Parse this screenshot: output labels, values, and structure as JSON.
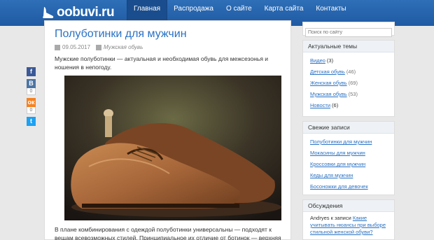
{
  "header": {
    "logo_text": "oobuvi.ru",
    "nav": [
      {
        "label": "Главная",
        "active": true
      },
      {
        "label": "Распродажа",
        "active": false
      },
      {
        "label": "О сайте",
        "active": false
      },
      {
        "label": "Карта сайта",
        "active": false
      },
      {
        "label": "Контакты",
        "active": false
      }
    ]
  },
  "share": {
    "facebook": {
      "icon": "f",
      "count": ""
    },
    "vk": {
      "icon": "В",
      "count": "0"
    },
    "odnoklassniki": {
      "icon": "ок",
      "count": "0"
    },
    "twitter": {
      "icon": "t",
      "count": ""
    }
  },
  "post": {
    "title": "Полуботинки для мужчин",
    "date": "09.05.2017",
    "category": "Мужская обувь",
    "excerpt": "Мужские полуботинки — актуальная и необходимая обувь для межсезонья и ношения в непогоду.",
    "body": "В плане комбинирования с одеждой полуботинки универсальны — подходят к вещам всевозможных стилей. Принципиальное их отличие от ботинок — верхняя часть"
  },
  "sidebar": {
    "search_placeholder": "Поиск по сайту",
    "topics_title": "Актуальные темы",
    "topics": [
      {
        "label": "Видео",
        "count": "(3)"
      },
      {
        "label": "Детская обувь",
        "count": "(46)"
      },
      {
        "label": "Женская обувь",
        "count": "(69)"
      },
      {
        "label": "Мужская обувь",
        "count": "(53)"
      },
      {
        "label": "Новости",
        "count": "(6)"
      }
    ],
    "recent_title": "Свежие записи",
    "recent": [
      {
        "label": "Полуботинки для мужчин"
      },
      {
        "label": "Мокасины для мужчин"
      },
      {
        "label": "Кроссовки для мужчин"
      },
      {
        "label": "Кеды для мужчин"
      },
      {
        "label": "Босоножки для девочек"
      }
    ],
    "discussions_title": "Обсуждения",
    "discussion": {
      "author": "Andryes",
      "preposition": "к записи",
      "link": "Какие учитывать нюансы при выборе стильной женской обуви?"
    }
  },
  "colors": {
    "header": "#2a68b1",
    "link": "#2a72c4",
    "facebook": "#3b5998",
    "vk": "#4c75a3",
    "ok": "#f58220",
    "twitter": "#1da1f2"
  }
}
